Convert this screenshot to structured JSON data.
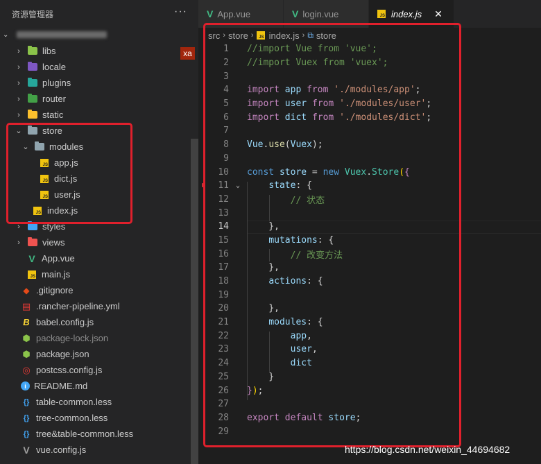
{
  "explorer": {
    "title": "资源管理器",
    "more_icon": "ellipsis-icon",
    "badge": "xa",
    "tree": [
      {
        "label": "libs",
        "type": "folder",
        "color": "#8bc34a"
      },
      {
        "label": "locale",
        "type": "folder",
        "color": "#7e57c2"
      },
      {
        "label": "plugins",
        "type": "folder",
        "color": "#26a69a"
      },
      {
        "label": "router",
        "type": "folder",
        "color": "#43a047"
      },
      {
        "label": "static",
        "type": "folder",
        "color": "#fbc02d"
      },
      {
        "label": "store",
        "type": "folder-open"
      },
      {
        "label": "modules",
        "type": "folder-open"
      },
      {
        "label": "app.js",
        "type": "js"
      },
      {
        "label": "dict.js",
        "type": "js"
      },
      {
        "label": "user.js",
        "type": "js"
      },
      {
        "label": "index.js",
        "type": "js"
      },
      {
        "label": "styles",
        "type": "folder",
        "color": "#42a5f5"
      },
      {
        "label": "views",
        "type": "folder",
        "color": "#ef5350"
      },
      {
        "label": "App.vue",
        "type": "vue"
      },
      {
        "label": "main.js",
        "type": "js"
      },
      {
        "label": ".gitignore",
        "type": "git"
      },
      {
        "label": ".rancher-pipeline.yml",
        "type": "yml"
      },
      {
        "label": "babel.config.js",
        "type": "babel"
      },
      {
        "label": "package-lock.json",
        "type": "node"
      },
      {
        "label": "package.json",
        "type": "node"
      },
      {
        "label": "postcss.config.js",
        "type": "postcss"
      },
      {
        "label": "README.md",
        "type": "info"
      },
      {
        "label": "table-common.less",
        "type": "less"
      },
      {
        "label": "tree-common.less",
        "type": "less"
      },
      {
        "label": "tree&table-common.less",
        "type": "less"
      },
      {
        "label": "vue.config.js",
        "type": "vueconfig"
      }
    ]
  },
  "tabs": [
    {
      "label": "App.vue",
      "icon": "vue-icon",
      "active": false
    },
    {
      "label": "login.vue",
      "icon": "vue-icon",
      "active": false
    },
    {
      "label": "index.js",
      "icon": "js-icon",
      "active": true,
      "close": "✕"
    }
  ],
  "breadcrumb": {
    "src": "src",
    "store": "store",
    "file": "index.js",
    "symbol": "store"
  },
  "code": {
    "line_numbers": [
      "1",
      "2",
      "3",
      "4",
      "5",
      "6",
      "7",
      "8",
      "9",
      "10",
      "11",
      "12",
      "13",
      "14",
      "15",
      "16",
      "17",
      "18",
      "19",
      "20",
      "21",
      "22",
      "23",
      "24",
      "25",
      "26",
      "27",
      "28",
      "29"
    ],
    "lines": [
      [
        [
          "cmt",
          "//import Vue from 'vue';"
        ]
      ],
      [
        [
          "cmt",
          "//import Vuex from 'vuex';"
        ]
      ],
      [],
      [
        [
          "kw2",
          "import"
        ],
        [
          "src",
          " "
        ],
        [
          "var",
          "app"
        ],
        [
          "src",
          " "
        ],
        [
          "kw2",
          "from"
        ],
        [
          "src",
          " "
        ],
        [
          "str",
          "'./modules/app'"
        ],
        [
          "src",
          ";"
        ]
      ],
      [
        [
          "kw2",
          "import"
        ],
        [
          "src",
          " "
        ],
        [
          "var",
          "user"
        ],
        [
          "src",
          " "
        ],
        [
          "kw2",
          "from"
        ],
        [
          "src",
          " "
        ],
        [
          "str",
          "'./modules/user'"
        ],
        [
          "src",
          ";"
        ]
      ],
      [
        [
          "kw2",
          "import"
        ],
        [
          "src",
          " "
        ],
        [
          "var",
          "dict"
        ],
        [
          "src",
          " "
        ],
        [
          "kw2",
          "from"
        ],
        [
          "src",
          " "
        ],
        [
          "str",
          "'./modules/dict'"
        ],
        [
          "src",
          ";"
        ]
      ],
      [],
      [
        [
          "var",
          "Vue"
        ],
        [
          "src",
          "."
        ],
        [
          "fn",
          "use"
        ],
        [
          "src",
          "("
        ],
        [
          "var",
          "Vuex"
        ],
        [
          "src",
          ");"
        ]
      ],
      [],
      [
        [
          "kw",
          "const"
        ],
        [
          "src",
          " "
        ],
        [
          "var",
          "store"
        ],
        [
          "src",
          " = "
        ],
        [
          "kw",
          "new"
        ],
        [
          "src",
          " "
        ],
        [
          "cls",
          "Vuex"
        ],
        [
          "src",
          "."
        ],
        [
          "cls",
          "Store"
        ],
        [
          "br",
          "("
        ],
        [
          "kw2",
          "{"
        ]
      ],
      [
        [
          "src",
          "    "
        ],
        [
          "var",
          "state"
        ],
        [
          "src",
          ": {"
        ]
      ],
      [
        [
          "src",
          "        "
        ],
        [
          "cmt",
          "// 状态"
        ]
      ],
      [],
      [
        [
          "src",
          "    },"
        ]
      ],
      [
        [
          "src",
          "    "
        ],
        [
          "var",
          "mutations"
        ],
        [
          "src",
          ": {"
        ]
      ],
      [
        [
          "src",
          "        "
        ],
        [
          "cmt",
          "// 改变方法"
        ]
      ],
      [
        [
          "src",
          "    },"
        ]
      ],
      [
        [
          "src",
          "    "
        ],
        [
          "var",
          "actions"
        ],
        [
          "src",
          ": {"
        ]
      ],
      [],
      [
        [
          "src",
          "    },"
        ]
      ],
      [
        [
          "src",
          "    "
        ],
        [
          "var",
          "modules"
        ],
        [
          "src",
          ": {"
        ]
      ],
      [
        [
          "src",
          "        "
        ],
        [
          "var",
          "app"
        ],
        [
          "src",
          ","
        ]
      ],
      [
        [
          "src",
          "        "
        ],
        [
          "var",
          "user"
        ],
        [
          "src",
          ","
        ]
      ],
      [
        [
          "src",
          "        "
        ],
        [
          "var",
          "dict"
        ]
      ],
      [
        [
          "src",
          "    }"
        ]
      ],
      [
        [
          "kw2",
          "}"
        ],
        [
          "br",
          ")"
        ],
        [
          "src",
          ";"
        ]
      ],
      [],
      [
        [
          "kw2",
          "export"
        ],
        [
          "src",
          " "
        ],
        [
          "kw2",
          "default"
        ],
        [
          "src",
          " "
        ],
        [
          "var",
          "store"
        ],
        [
          "src",
          ";"
        ]
      ],
      []
    ]
  },
  "watermark": "https://blog.csdn.net/weixin_44694682"
}
